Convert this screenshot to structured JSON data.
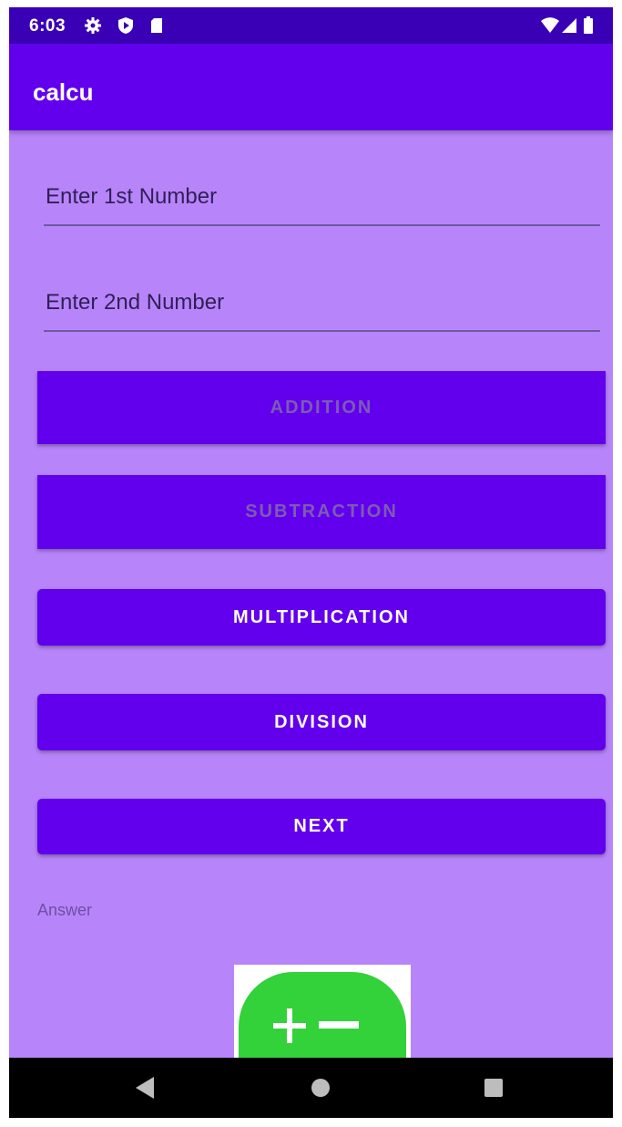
{
  "status_bar": {
    "time": "6:03",
    "icons": [
      "settings-icon",
      "play-protect-icon",
      "sd-card-icon"
    ],
    "right_icons": [
      "wifi-icon",
      "signal-icon",
      "battery-icon"
    ]
  },
  "app_bar": {
    "title": "calcu"
  },
  "form": {
    "first_number": {
      "value": "",
      "placeholder": "Enter 1st Number"
    },
    "second_number": {
      "value": "",
      "placeholder": "Enter 2nd Number"
    }
  },
  "buttons": {
    "addition": "ADDITION",
    "subtraction": "SUBTRACTION",
    "multiplication": "MULTIPLICATION",
    "division": "DIVISION",
    "next": "NEXT"
  },
  "answer": {
    "label": "Answer"
  },
  "logo": {
    "icon": "plus-minus-logo"
  },
  "nav_bar": {
    "icons": [
      "back-icon",
      "home-icon",
      "recents-icon"
    ]
  },
  "colors": {
    "primary": "#6200ee",
    "primary_dark": "#3a00b5",
    "background": "#b785f9",
    "logo_green": "#33d13a"
  }
}
